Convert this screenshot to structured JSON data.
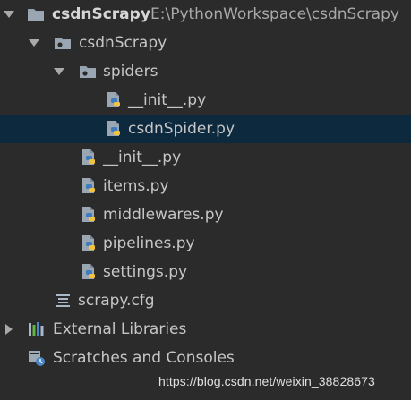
{
  "tree": {
    "root": {
      "name": "csdnScrapy",
      "path": "E:\\PythonWorkspace\\csdnScrapy",
      "expanded": true,
      "icon": "folder-icon"
    },
    "package": {
      "name": "csdnScrapy",
      "expanded": true,
      "icon": "package-folder-icon"
    },
    "spiders": {
      "name": "spiders",
      "expanded": true,
      "icon": "package-folder-icon",
      "files": [
        {
          "name": "__init__.py",
          "icon": "python-file-icon"
        },
        {
          "name": "csdnSpider.py",
          "icon": "python-file-icon",
          "selected": true
        }
      ]
    },
    "package_files": [
      {
        "name": "__init__.py",
        "icon": "python-file-icon"
      },
      {
        "name": "items.py",
        "icon": "python-file-icon"
      },
      {
        "name": "middlewares.py",
        "icon": "python-file-icon"
      },
      {
        "name": "pipelines.py",
        "icon": "python-file-icon"
      },
      {
        "name": "settings.py",
        "icon": "python-file-icon"
      }
    ],
    "config_file": {
      "name": "scrapy.cfg",
      "icon": "config-file-icon"
    },
    "external_libraries": {
      "name": "External Libraries",
      "expanded": false,
      "icon": "library-icon"
    },
    "scratches": {
      "name": "Scratches and Consoles",
      "icon": "scratches-icon"
    }
  },
  "watermark": "https://blog.csdn.net/weixin_38828673",
  "colors": {
    "background": "#2b2b2b",
    "selection": "#0d293e",
    "text": "#c6c6c6",
    "path_text": "#a9a9a9",
    "python_blue": "#3f7cbf",
    "python_yellow": "#f2c43d"
  }
}
